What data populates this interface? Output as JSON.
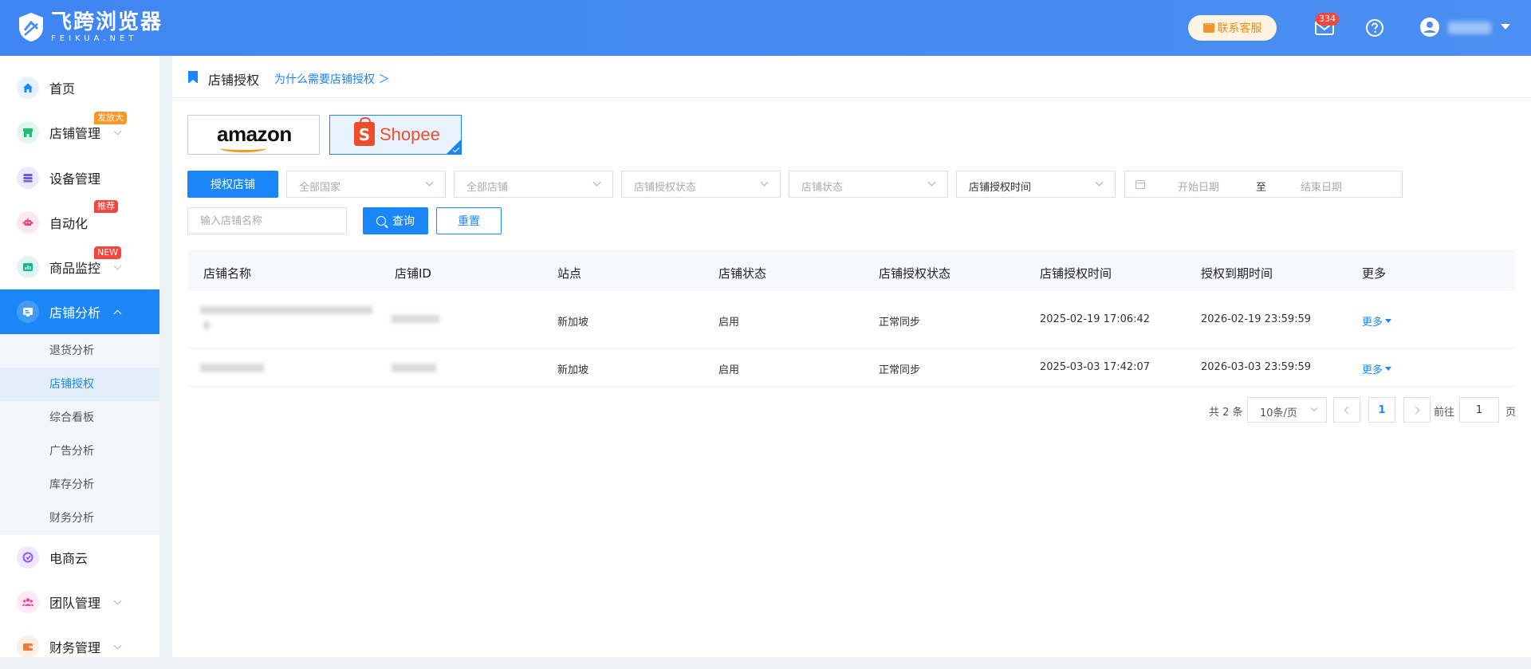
{
  "header": {
    "logo_name": "飞跨浏览器",
    "logo_sub": "FEIKUA.NET",
    "support_label": "联系客服",
    "mail_count": "334",
    "brand_color": "#4a8cf1"
  },
  "sidebar": {
    "items": [
      {
        "label": "首页",
        "icon": "home-icon"
      },
      {
        "label": "店铺管理",
        "icon": "store-icon",
        "badge": "发放大"
      },
      {
        "label": "设备管理",
        "icon": "device-icon"
      },
      {
        "label": "自动化",
        "icon": "robot-icon",
        "badge": "推荐"
      },
      {
        "label": "商品监控",
        "icon": "monitor-icon",
        "badge": "NEW"
      },
      {
        "label": "店铺分析",
        "icon": "analysis-icon"
      },
      {
        "label": "电商云",
        "icon": "cloud-icon"
      },
      {
        "label": "团队管理",
        "icon": "team-icon"
      },
      {
        "label": "财务管理",
        "icon": "wallet-icon"
      }
    ],
    "sub_items": [
      "退货分析",
      "店铺授权",
      "综合看板",
      "广告分析",
      "库存分析",
      "财务分析"
    ],
    "active_color": "#1b86f5"
  },
  "breadcrumb": {
    "title": "店铺授权",
    "link": "为什么需要店铺授权 ＞"
  },
  "platforms": [
    {
      "name": "amazon"
    },
    {
      "name": "Shopee",
      "selected": true
    }
  ],
  "filters": {
    "auth_button": "授权店铺",
    "country": "全部国家",
    "store": "全部店铺",
    "auth_status": "店铺授权状态",
    "store_status": "店铺状态",
    "time_type": "店铺授权时间",
    "date_start": "开始日期",
    "date_sep": "至",
    "date_end": "结束日期",
    "name_placeholder": "输入店铺名称",
    "query_button": "查询",
    "reset_button": "重置"
  },
  "table": {
    "columns": [
      "店铺名称",
      "店铺ID",
      "站点",
      "店铺状态",
      "店铺授权状态",
      "店铺授权时间",
      "授权到期时间",
      "更多"
    ],
    "rows": [
      {
        "site": "新加坡",
        "status": "启用",
        "auth_status": "正常同步",
        "auth_time": "2025-02-19 17:06:42",
        "expire_time": "2026-02-19 23:59:59",
        "more": "更多"
      },
      {
        "site": "新加坡",
        "status": "启用",
        "auth_status": "正常同步",
        "auth_time": "2025-03-03 17:42:07",
        "expire_time": "2026-03-03 23:59:59",
        "more": "更多"
      }
    ]
  },
  "pagination": {
    "total": "共 2 条",
    "page_size": "10条/页",
    "current_page": "1",
    "goto_label": "前往",
    "goto_value": "1",
    "page_suffix": "页"
  }
}
